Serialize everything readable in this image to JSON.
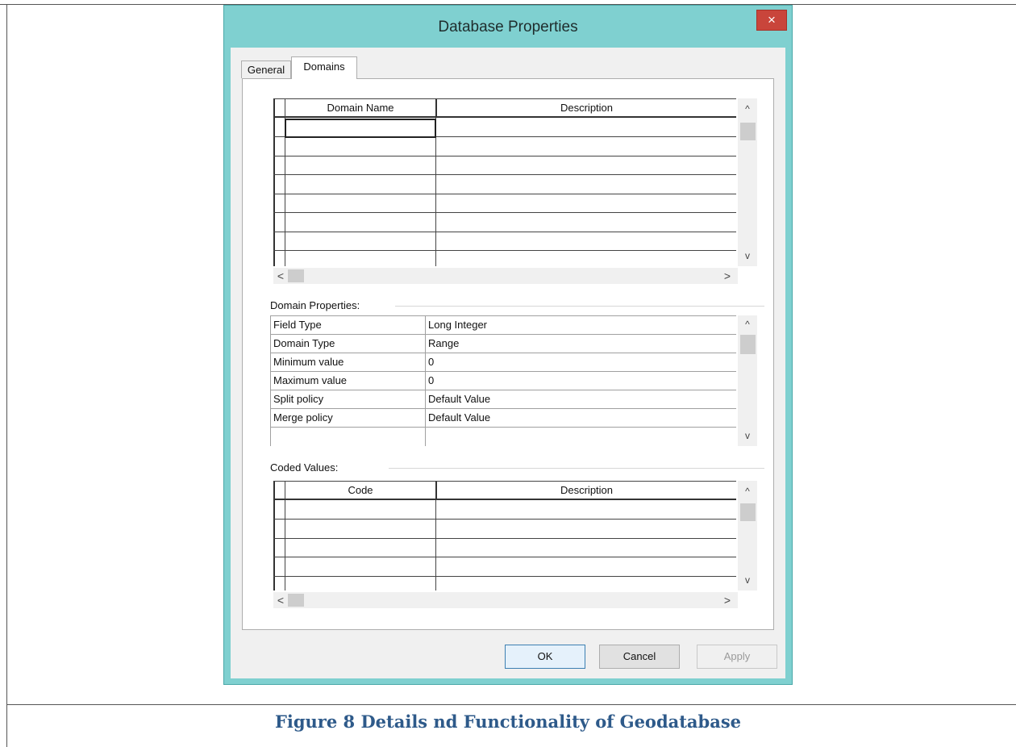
{
  "dialog": {
    "title": "Database Properties",
    "close_glyph": "×"
  },
  "tabs": [
    {
      "label": "General",
      "active": false
    },
    {
      "label": "Domains",
      "active": true
    }
  ],
  "domains_grid": {
    "columns": [
      "Domain Name",
      "Description"
    ],
    "rows": [
      [
        "",
        ""
      ],
      [
        "",
        ""
      ],
      [
        "",
        ""
      ],
      [
        "",
        ""
      ],
      [
        "",
        ""
      ],
      [
        "",
        ""
      ],
      [
        "",
        ""
      ],
      [
        "",
        ""
      ]
    ]
  },
  "domain_properties": {
    "label": "Domain Properties:",
    "rows": [
      {
        "key": "Field Type",
        "value": "Long Integer"
      },
      {
        "key": "Domain Type",
        "value": "Range"
      },
      {
        "key": "Minimum value",
        "value": "0"
      },
      {
        "key": "Maximum value",
        "value": "0"
      },
      {
        "key": "Split policy",
        "value": "Default Value"
      },
      {
        "key": "Merge policy",
        "value": "Default Value"
      }
    ]
  },
  "coded_values": {
    "label": "Coded Values:",
    "columns": [
      "Code",
      "Description"
    ]
  },
  "scroll_glyphs": {
    "up": "^",
    "down": "v",
    "left": "<",
    "right": ">"
  },
  "buttons": {
    "ok": "OK",
    "cancel": "Cancel",
    "apply": "Apply"
  },
  "caption": "Figure 8 Details nd Functionality of Geodatabase",
  "colors": {
    "window_frame": "#7fd0d0",
    "close_button": "#c9453b",
    "caption": "#2e5a8a"
  }
}
